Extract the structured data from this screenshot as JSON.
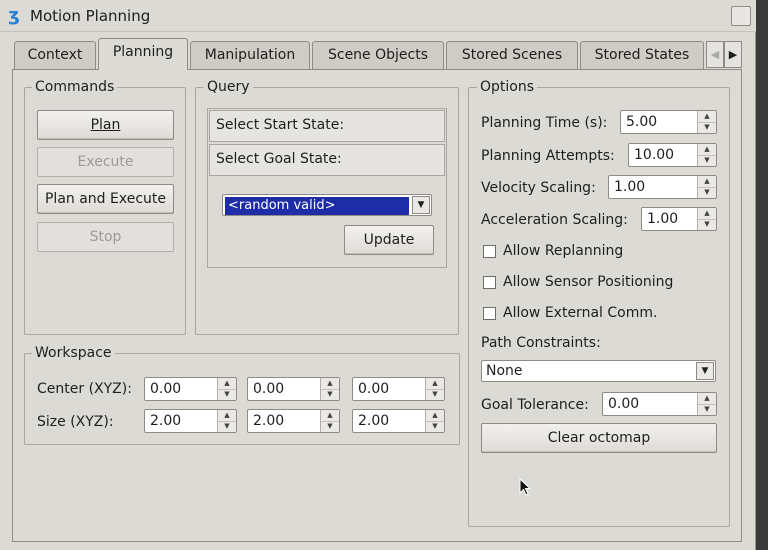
{
  "window": {
    "title": "Motion Planning",
    "icon": "rviz-panel-icon"
  },
  "tabs": [
    {
      "label": "Context"
    },
    {
      "label": "Planning",
      "active": true
    },
    {
      "label": "Manipulation"
    },
    {
      "label": "Scene Objects"
    },
    {
      "label": "Stored Scenes"
    },
    {
      "label": "Stored States"
    }
  ],
  "commands": {
    "title": "Commands",
    "plan": "Plan",
    "execute": "Execute",
    "plan_and_execute": "Plan and Execute",
    "stop": "Stop"
  },
  "query": {
    "title": "Query",
    "select_start": "Select Start State:",
    "select_goal": "Select Goal State:",
    "goal_option": "<random valid>",
    "update": "Update"
  },
  "workspace": {
    "title": "Workspace",
    "center_label": "Center (XYZ):",
    "center": [
      "0.00",
      "0.00",
      "0.00"
    ],
    "size_label": "Size (XYZ):",
    "size": [
      "2.00",
      "2.00",
      "2.00"
    ]
  },
  "options": {
    "title": "Options",
    "planning_time_label": "Planning Time (s):",
    "planning_time": "5.00",
    "planning_attempts_label": "Planning Attempts:",
    "planning_attempts": "10.00",
    "velocity_scaling_label": "Velocity Scaling:",
    "velocity_scaling": "1.00",
    "acceleration_scaling_label": "Acceleration Scaling:",
    "acceleration_scaling": "1.00",
    "allow_replanning": "Allow Replanning",
    "allow_sensor_positioning": "Allow Sensor Positioning",
    "allow_external_comm": "Allow External Comm.",
    "path_constraints_label": "Path Constraints:",
    "path_constraints": "None",
    "goal_tolerance_label": "Goal Tolerance:",
    "goal_tolerance": "0.00",
    "clear_octomap": "Clear octomap"
  }
}
